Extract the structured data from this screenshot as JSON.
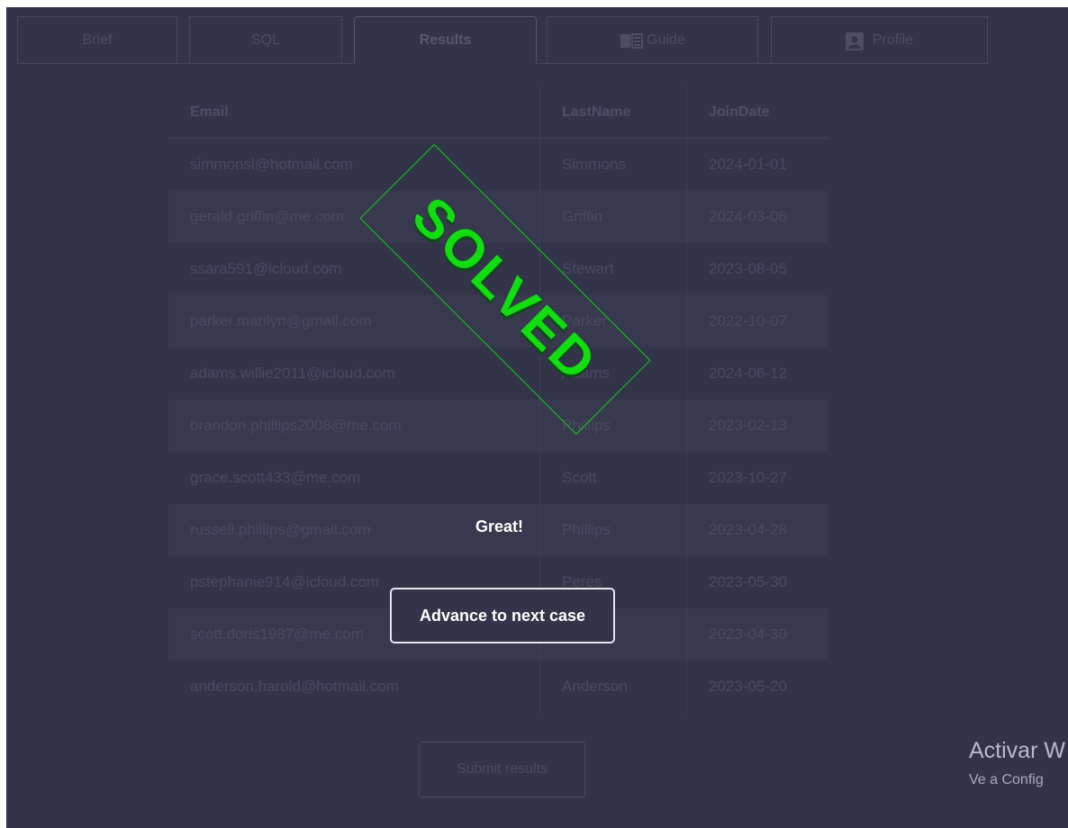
{
  "tabs": [
    {
      "label": "Brief",
      "icon": "",
      "active": false
    },
    {
      "label": "SQL",
      "icon": "",
      "active": false
    },
    {
      "label": "Results",
      "icon": "",
      "active": true
    },
    {
      "label": "Guide",
      "icon": "book-icon",
      "active": false
    },
    {
      "label": "Profile",
      "icon": "contact-card-icon",
      "active": false
    }
  ],
  "table": {
    "columns": [
      "Email",
      "LastName",
      "JoinDate"
    ],
    "rows": [
      [
        "simmonsl@hotmail.com",
        "Simmons",
        "2024-01-01"
      ],
      [
        "gerald.griffin@me.com",
        "Griffin",
        "2024-03-06"
      ],
      [
        "ssara591@icloud.com",
        "Stewart",
        "2023-08-05"
      ],
      [
        "parker.marilyn@gmail.com",
        "Parker",
        "2022-10-07"
      ],
      [
        "adams.willie2011@icloud.com",
        "Adams",
        "2024-06-12"
      ],
      [
        "brandon.phillips2008@me.com",
        "Phillips",
        "2023-02-13"
      ],
      [
        "grace.scott433@me.com",
        "Scott",
        "2023-10-27"
      ],
      [
        "russell.phillips@gmail.com",
        "Phillips",
        "2023-04-28"
      ],
      [
        "pstephanie914@icloud.com",
        "Peres",
        "2023-05-30"
      ],
      [
        "scott.doris1987@me.com",
        "Scott",
        "2023-04-30"
      ],
      [
        "anderson.harold@hotmail.com",
        "Anderson",
        "2023-05-20"
      ]
    ]
  },
  "submit_label": "Submit results",
  "overlay": {
    "stamp_text": "SOLVED",
    "message": "Great!",
    "advance_label": "Advance to next case"
  },
  "watermark": {
    "title": "Activar W",
    "subtitle": "Ve a Config"
  },
  "colors": {
    "background": "#33334a",
    "stamp_green": "#11dd11",
    "text_white": "#ffffff"
  }
}
